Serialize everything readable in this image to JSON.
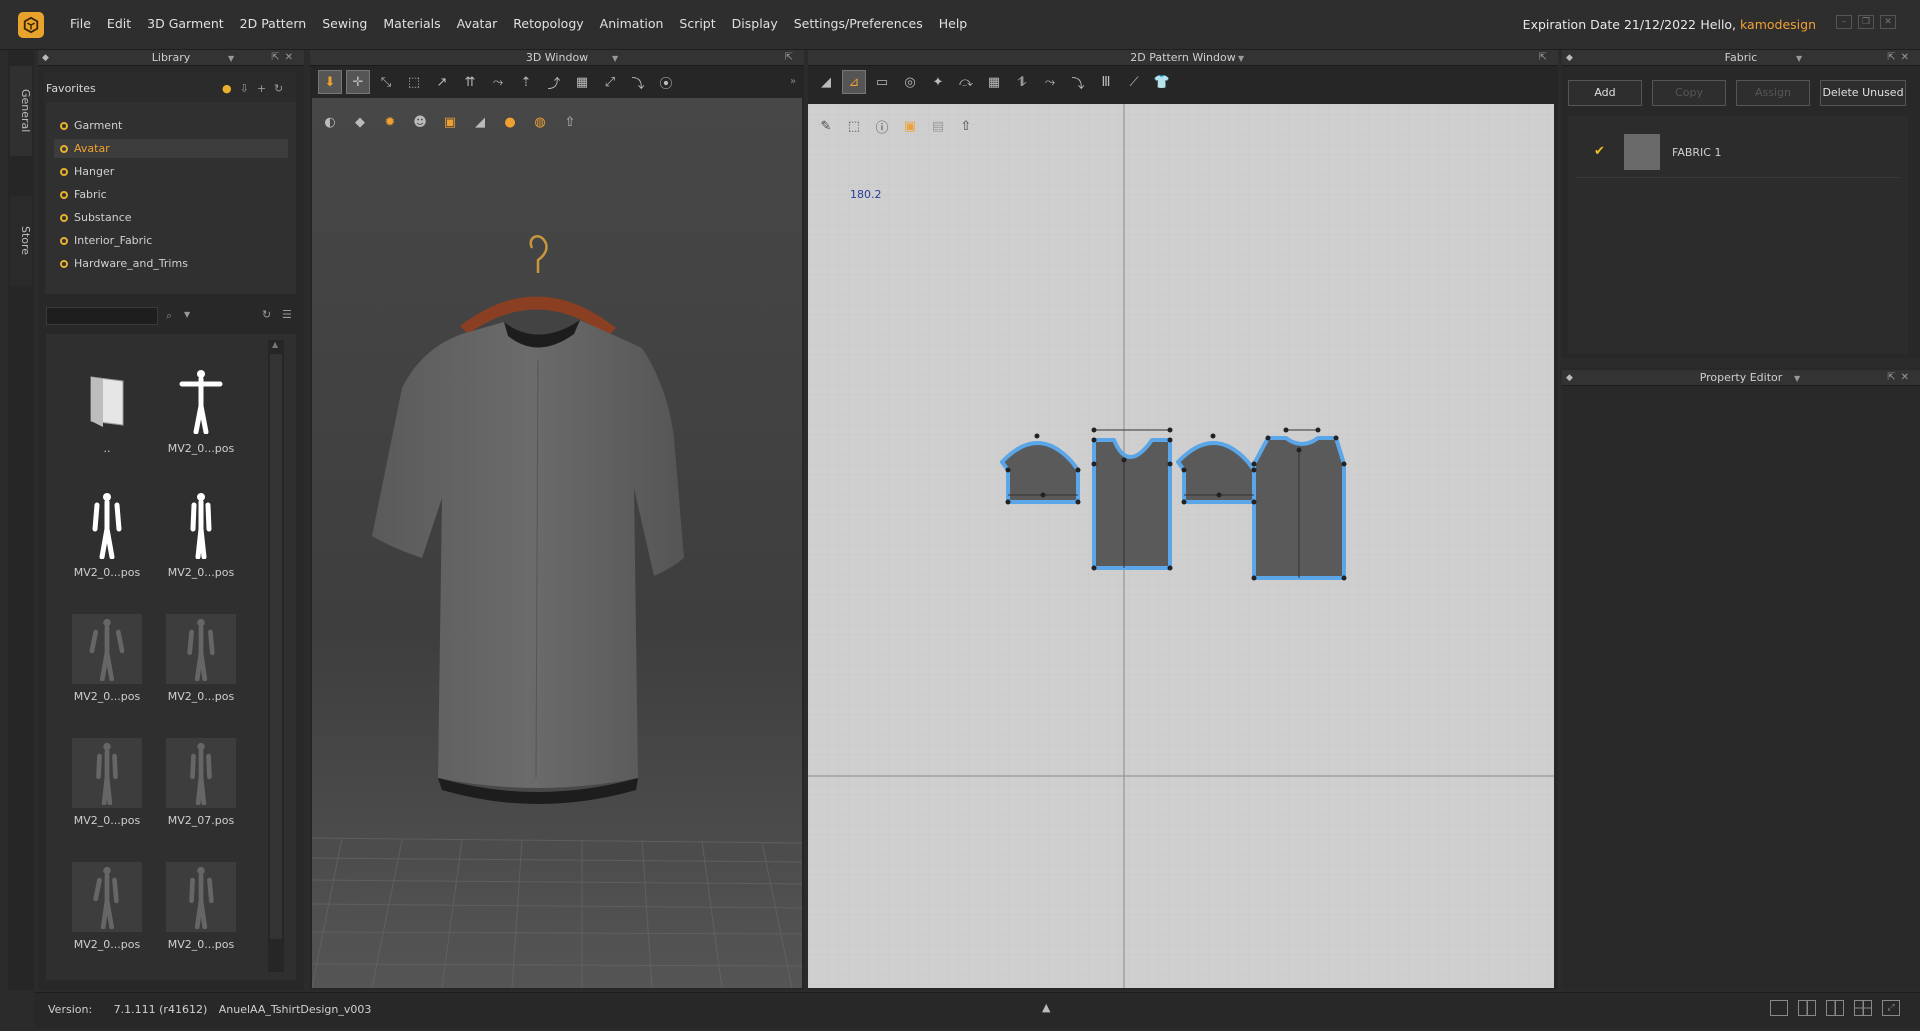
{
  "menubar": {
    "items": [
      "File",
      "Edit",
      "3D Garment",
      "2D Pattern",
      "Sewing",
      "Materials",
      "Avatar",
      "Retopology",
      "Animation",
      "Script",
      "Display",
      "Settings/Preferences",
      "Help"
    ],
    "expiration": "Expiration Date 21/12/2022",
    "hello_prefix": "Hello, ",
    "username": "kamodesign"
  },
  "sidetabs": {
    "general": "General",
    "store": "Store"
  },
  "library": {
    "title": "Library",
    "favorites_title": "Favorites",
    "favorites": [
      "Garment",
      "Avatar",
      "Hanger",
      "Fabric",
      "Substance",
      "Interior_Fabric",
      "Hardware_and_Trims"
    ],
    "selected_favorite": "Avatar",
    "files": [
      {
        "label": ".."
      },
      {
        "label": "MV2_0...pos"
      },
      {
        "label": "MV2_0...pos"
      },
      {
        "label": "MV2_0...pos"
      },
      {
        "label": "MV2_0...pos"
      },
      {
        "label": "MV2_0...pos"
      },
      {
        "label": "MV2_0...pos"
      },
      {
        "label": "MV2_07.pos"
      },
      {
        "label": "MV2_0...pos"
      },
      {
        "label": "MV2_0...pos"
      }
    ]
  },
  "window3d": {
    "title": "3D Window"
  },
  "window2d": {
    "title": "2D Pattern Window",
    "coord": "180.2"
  },
  "fabric": {
    "title": "Fabric",
    "buttons": {
      "add": "Add",
      "copy": "Copy",
      "assign": "Assign",
      "delete": "Delete Unused"
    },
    "items": [
      {
        "name": "FABRIC 1",
        "color": "#6a6a6a"
      }
    ]
  },
  "property_editor": {
    "title": "Property Editor"
  },
  "status": {
    "version_label": "Version:",
    "version": "7.1.111 (r41612)",
    "file": "AnuelAA_TshirtDesign_v003"
  },
  "colors": {
    "accent": "#f0a030",
    "pattern_outline": "#5aa6e8",
    "pattern_fill": "#5a5a5a"
  }
}
